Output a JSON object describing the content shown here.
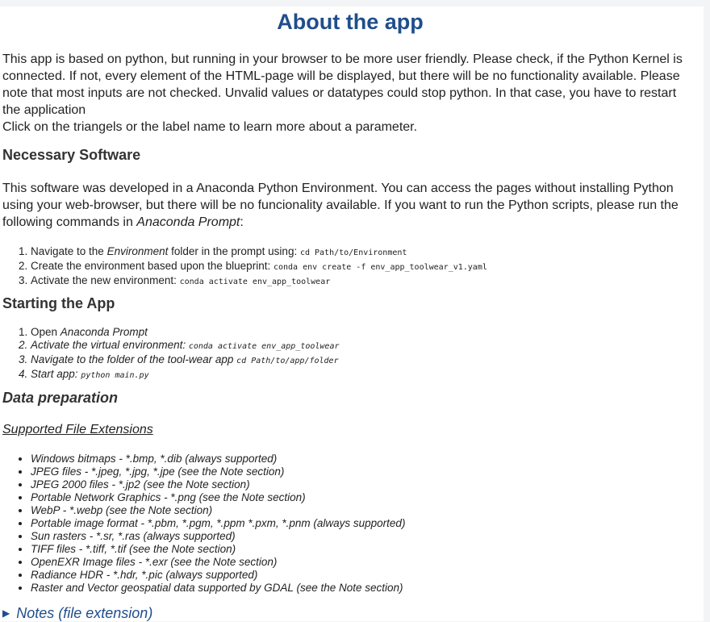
{
  "title": "About the app",
  "intro": {
    "para1": "This app is based on python, but running in your browser to be more user friendly. Please check, if the Python Kernel is connected. If not, every element of the HTML-page will be displayed, but there will be no functionality available. Please note that most inputs are not checked. Unvalid values or datatypes could stop python. In that case, you have to restart the application",
    "para2": "Click on the triangels or the label name to learn more about a parameter."
  },
  "necessary_software": {
    "heading": "Necessary Software",
    "text_before": "This software was developed in a Anaconda Python Environment. You can access the pages without installing Python using your web-browser, but there will be no funcionality available. If you want to run the Python scripts, please run the following commands in ",
    "text_em": "Anaconda Prompt",
    "text_after": ":",
    "steps": [
      {
        "pre": "Navigate to the ",
        "em": "Environment",
        "post": " folder in the prompt using: ",
        "code": "cd Path/to/Environment"
      },
      {
        "pre": "Create the environment based upon the blueprint: ",
        "em": "",
        "post": "",
        "code": "conda env create -f env_app_toolwear_v1.yaml"
      },
      {
        "pre": "Activate the new environment: ",
        "em": "",
        "post": "",
        "code": "conda activate env_app_toolwear"
      }
    ]
  },
  "starting": {
    "heading": "Starting the App",
    "step1_pre": "Open ",
    "step1_em": "Anaconda Prompt",
    "step2_text": "Activate the virtual environment: ",
    "step2_code": "conda activate env_app_toolwear",
    "step3_text": "Navigate to the folder of the tool-wear app ",
    "step3_code": "cd Path/to/app/folder",
    "step4_text": "Start app: ",
    "step4_code": "python main.py"
  },
  "data_prep": {
    "heading": "Data preparation",
    "subheading": "Supported File Extensions",
    "extensions": [
      "Windows bitmaps - *.bmp, *.dib (always supported)",
      "JPEG files - *.jpeg, *.jpg, *.jpe (see the Note section)",
      "JPEG 2000 files - *.jp2 (see the Note section)",
      "Portable Network Graphics - *.png (see the Note section)",
      "WebP - *.webp (see the Note section)",
      "Portable image format - *.pbm, *.pgm, *.ppm *.pxm, *.pnm (always supported)",
      "Sun rasters - *.sr, *.ras (always supported)",
      "TIFF files - *.tiff, *.tif (see the Note section)",
      "OpenEXR Image files - *.exr (see the Note section)",
      "Radiance HDR - *.hdr, *.pic (always supported)",
      "Raster and Vector geospatial data supported by GDAL (see the Note section)"
    ],
    "notes_label": "Notes (file extension)",
    "notes_icon": "triangle-right-icon"
  }
}
